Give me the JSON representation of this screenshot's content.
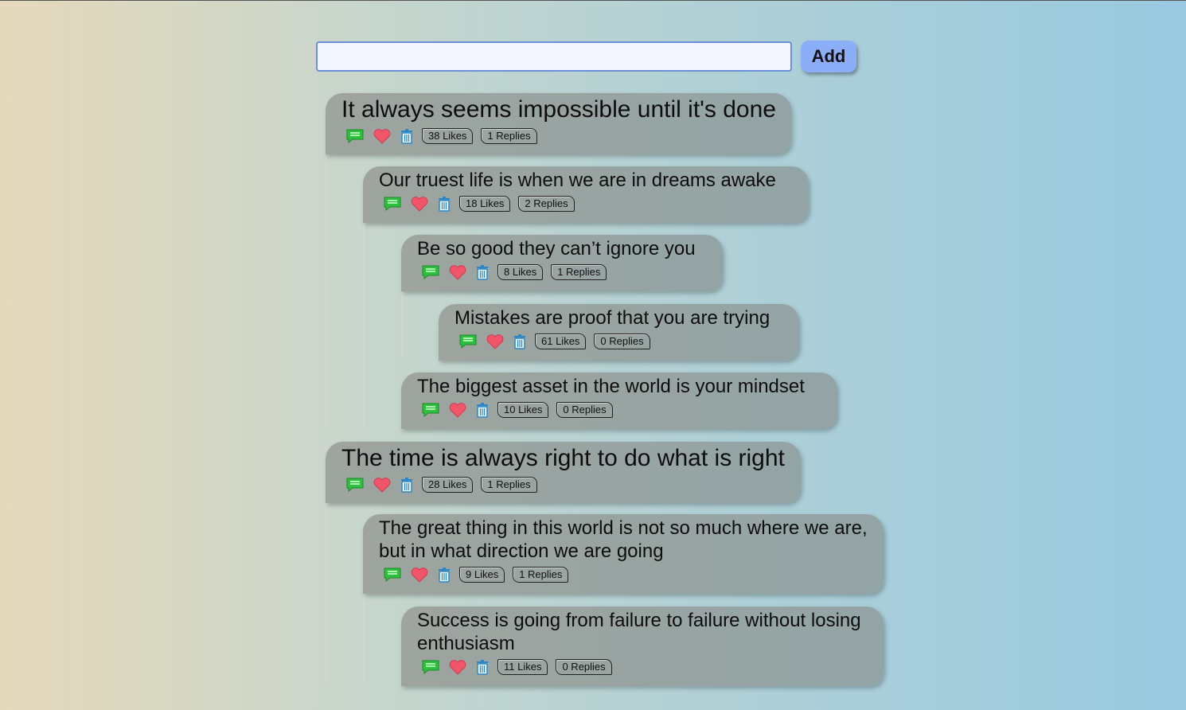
{
  "composer": {
    "input_value": "",
    "add_label": "Add"
  },
  "comments": [
    {
      "text": "It always seems impossible until it's done",
      "likes": "38 Likes",
      "replies": "1 Replies"
    },
    {
      "text": "Our truest life is when we are in dreams awake",
      "likes": "18 Likes",
      "replies": "2 Replies"
    },
    {
      "text": "Be so good they can’t ignore you",
      "likes": "8 Likes",
      "replies": "1 Replies"
    },
    {
      "text": "Mistakes are proof that you are trying",
      "likes": "61 Likes",
      "replies": "0 Replies"
    },
    {
      "text": "The biggest asset in the world is your mindset",
      "likes": "10 Likes",
      "replies": "0 Replies"
    },
    {
      "text": "The time is always right to do what is right",
      "likes": "28 Likes",
      "replies": "1 Replies"
    },
    {
      "text": "The great thing in this world is not so much where we are, but in what direction we are going",
      "likes": "9 Likes",
      "replies": "1 Replies"
    },
    {
      "text": "Success is going from failure to failure without losing enthusiasm",
      "likes": "11 Likes",
      "replies": "0 Replies"
    }
  ],
  "icons": {
    "reply": "reply-bubble-icon",
    "like": "heart-icon",
    "delete": "trash-icon"
  },
  "colors": {
    "add_button": "#8cadf7",
    "input_border": "#6d8fd6",
    "reply_icon": "#2fbf3f",
    "heart_icon": "#f0556a",
    "trash_icon": "#2a86c8"
  }
}
